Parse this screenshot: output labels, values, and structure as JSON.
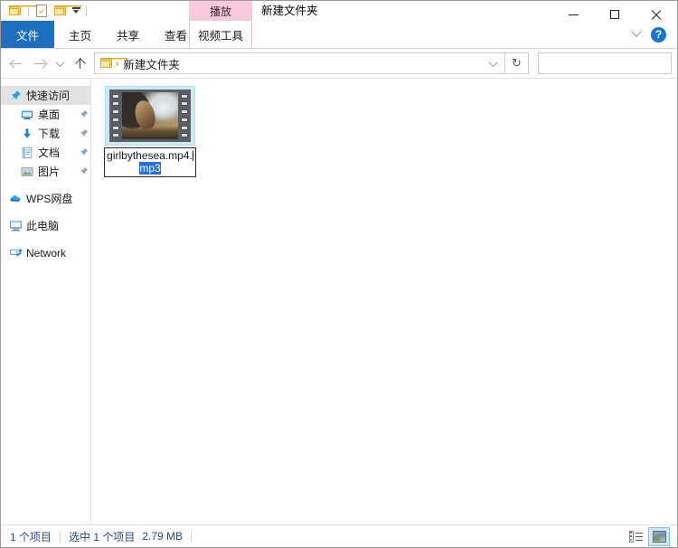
{
  "window": {
    "title": "新建文件夹",
    "contextual_group_label": "播放",
    "controls": {
      "minimize": "minimize-button",
      "maximize": "maximize-button",
      "close": "close-button"
    }
  },
  "quick_access_toolbar": {
    "items": [
      {
        "name": "folder-icon",
        "label": ""
      },
      {
        "name": "properties-icon",
        "label": ""
      },
      {
        "name": "new-folder-icon",
        "label": ""
      }
    ],
    "customize_label": ""
  },
  "ribbon": {
    "tabs": [
      {
        "label": "文件",
        "selected": true
      },
      {
        "label": "主页",
        "selected": false
      },
      {
        "label": "共享",
        "selected": false
      },
      {
        "label": "查看",
        "selected": false
      }
    ],
    "contextual_tab": {
      "label": "视频工具"
    },
    "collapse_label": "",
    "help_label": "?"
  },
  "addressbar": {
    "back_label": "",
    "forward_label": "",
    "recent_label": "",
    "up_label": "",
    "breadcrumb": [
      {
        "label": "新建文件夹"
      }
    ],
    "breadcrumb_separator": "›",
    "dropdown_label": "",
    "refresh_label": "↻"
  },
  "search": {
    "value": "",
    "placeholder": ""
  },
  "sidebar": {
    "groups": [
      {
        "name": "quick-access",
        "label": "快速访问",
        "icon": "pin-icon",
        "items": [
          {
            "label": "桌面",
            "icon": "desktop-icon",
            "pinned": true
          },
          {
            "label": "下载",
            "icon": "download-icon",
            "pinned": true
          },
          {
            "label": "文档",
            "icon": "document-icon",
            "pinned": true
          },
          {
            "label": "图片",
            "icon": "pictures-icon",
            "pinned": true
          }
        ]
      }
    ],
    "roots": [
      {
        "label": "WPS网盘",
        "icon": "cloud-icon"
      },
      {
        "label": "此电脑",
        "icon": "this-pc-icon"
      },
      {
        "label": "Network",
        "icon": "network-icon"
      }
    ]
  },
  "file_pane": {
    "items": [
      {
        "name": "girlbythesea.mp4.mp3",
        "icon": "video-thumbnail",
        "renaming": true,
        "rename_text_unselected": "girlbythesea.mp4.",
        "rename_text_selected": "mp3"
      }
    ]
  },
  "statusbar": {
    "item_count": "1 个项目",
    "selection": "选中 1 个项目",
    "size": "2.79 MB",
    "views": [
      {
        "name": "details-view-button",
        "active": false
      },
      {
        "name": "large-icons-view-button",
        "active": true
      }
    ]
  },
  "colors": {
    "file_tab_blue": "#1e6fbf",
    "contextual_pink": "#f7c9dd",
    "selection_blue": "#2a6fd6",
    "thumb_select_bg": "#cde8f7",
    "status_text": "#2a4b7c"
  }
}
